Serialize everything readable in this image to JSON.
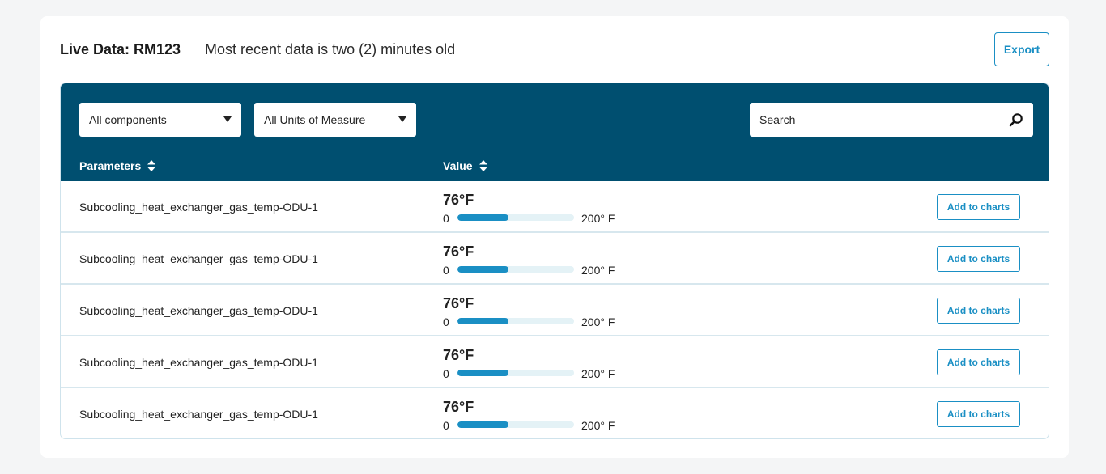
{
  "header": {
    "title": "Live Data: RM123",
    "status": "Most recent data is two (2) minutes old",
    "export_label": "Export"
  },
  "filters": {
    "components": "All components",
    "units": "All Units of Measure",
    "search_placeholder": "Search"
  },
  "columns": {
    "parameters": "Parameters",
    "value": "Value"
  },
  "rows": [
    {
      "parameter": "Subcooling_heat_exchanger_gas_temp-ODU-1",
      "value": "76°F",
      "min": "0",
      "max": "200° F",
      "fill_fraction": 0.44,
      "action": "Add to charts"
    },
    {
      "parameter": "Subcooling_heat_exchanger_gas_temp-ODU-1",
      "value": "76°F",
      "min": "0",
      "max": "200° F",
      "fill_fraction": 0.44,
      "action": "Add to charts"
    },
    {
      "parameter": "Subcooling_heat_exchanger_gas_temp-ODU-1",
      "value": "76°F",
      "min": "0",
      "max": "200° F",
      "fill_fraction": 0.44,
      "action": "Add to charts"
    },
    {
      "parameter": "Subcooling_heat_exchanger_gas_temp-ODU-1",
      "value": "76°F",
      "min": "0",
      "max": "200° F",
      "fill_fraction": 0.44,
      "action": "Add to charts"
    },
    {
      "parameter": "Subcooling_heat_exchanger_gas_temp-ODU-1",
      "value": "76°F",
      "min": "0",
      "max": "200° F",
      "fill_fraction": 0.44,
      "action": "Add to charts"
    }
  ],
  "colors": {
    "toolbar": "#004f70",
    "accent": "#1a8fc4",
    "track": "#e4f2f6",
    "background": "#f4f5f6"
  },
  "icons": {
    "search": "search-icon",
    "dropdown": "caret-down-icon",
    "sort": "sort-icon"
  }
}
